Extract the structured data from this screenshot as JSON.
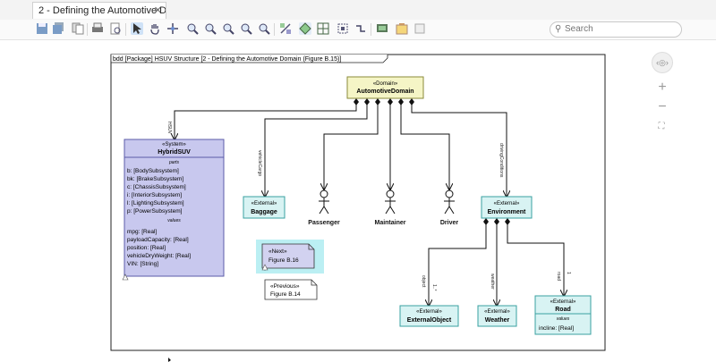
{
  "tab": {
    "title": "2 - Defining the Automotive D...",
    "close": "✕"
  },
  "search": {
    "placeholder": "Search"
  },
  "toolbar": [
    "save-icon",
    "save-all-icon",
    "print-icon",
    "print-preview-icon",
    "select-icon",
    "pan-icon",
    "move-icon",
    "zoom-in-icon",
    "zoom-out-icon",
    "zoom-100-icon",
    "zoom-fit-icon",
    "zoom-selection-icon",
    "layout-icon",
    "align-icon",
    "grid-icon",
    "snap-icon",
    "route-icon",
    "fit-icon",
    "screenshot-icon",
    "note-icon",
    "export-icon"
  ],
  "diagram": {
    "frame_title": "bdd [Package] HSUV Structure [2 - Defining the Automotive Domain (Figure B.15)]",
    "automotive_domain": {
      "stereotype": "«Domain»",
      "name": "AutomotiveDomain"
    },
    "hybrid_suv": {
      "stereotype": "«System»",
      "name": "HybridSUV",
      "parts_label": "parts",
      "parts": [
        "b: [BodySubsystem]",
        "bk: [BrakeSubsystem]",
        "c: [ChassisSubsystem]",
        "i: [InteriorSubsystem]",
        "l: [LightingSubsystem]",
        "p: [PowerSubsystem]"
      ],
      "values_label": "values",
      "values": [
        "mpg: [Real]",
        "payloadCapacity: [Real]",
        "position: [Real]",
        "vehicleDryWeight: [Real]",
        "VIN: [String]"
      ]
    },
    "baggage": {
      "stereotype": "«External»",
      "name": "Baggage"
    },
    "environment": {
      "stereotype": "«External»",
      "name": "Environment"
    },
    "actors": [
      "Passenger",
      "Maintainer",
      "Driver"
    ],
    "external_object": {
      "stereotype": "«External»",
      "name": "ExternalObject"
    },
    "weather": {
      "stereotype": "«External»",
      "name": "Weather"
    },
    "road": {
      "stereotype": "«External»",
      "name": "Road",
      "values_label": "values",
      "value": "incline: [Real]"
    },
    "next_note": {
      "line1": "«Next»",
      "line2": "Figure B.16"
    },
    "prev_note": {
      "line1": "«Previous»",
      "line2": "Figure B.14"
    },
    "role_labels": {
      "hsuv": "HSUV",
      "vehicle_cargo": "vehicleCargo",
      "driving_conditions": "drivingConditions",
      "object": "object",
      "weather": "weather",
      "road": "road",
      "mult_one": "1",
      "mult_many": "1..*"
    }
  },
  "colors": {
    "domain_fill": "#f5f5c6",
    "system_fill": "#c8c8ee",
    "external_fill": "#d8f3f3",
    "note_highlight": "#9ee8ee"
  }
}
